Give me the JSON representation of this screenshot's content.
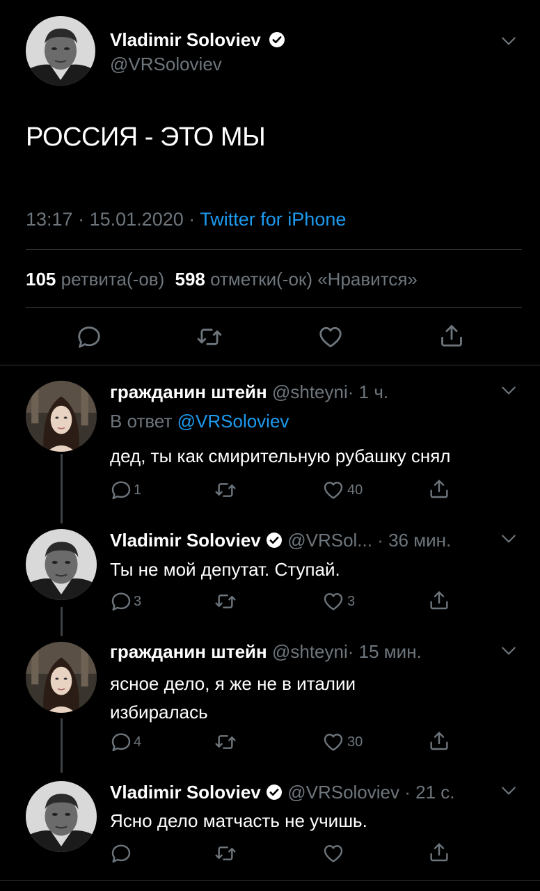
{
  "main_tweet": {
    "author_name": "Vladimir Soloviev",
    "handle": "@VRSoloviev",
    "text": "РОССИЯ - ЭТО МЫ",
    "time": "13:17",
    "sep1": "·",
    "date": "15.01.2020",
    "sep2": "·",
    "source": "Twitter for iPhone",
    "retweets_count": "105",
    "retweets_label": "ретвита(-ов)",
    "likes_count": "598",
    "likes_label": "отметки(-ок) «Нравится»"
  },
  "replies": [
    {
      "author_name": "гражданин штейн",
      "handle": "@shteyni",
      "time": "· 1 ч.",
      "reply_to_label": "В ответ",
      "reply_to_handle": "@VRSoloviev",
      "text": "дед, ты как смирительную рубашку снял",
      "reply_count": "1",
      "like_count": "40"
    },
    {
      "author_name": "Vladimir Soloviev",
      "handle": "@VRSol...",
      "time": "· 36 мин.",
      "text": "Ты не мой депутат. Ступай.",
      "reply_count": "3",
      "like_count": "3"
    },
    {
      "author_name": "гражданин штейн",
      "handle": "@shteyni",
      "time": "· 15 мин.",
      "text_line1": "ясное дело, я же не в италии",
      "text_line2": "избиралась",
      "reply_count": "4",
      "like_count": "30"
    },
    {
      "author_name": "Vladimir Soloviev",
      "handle": "@VRSoloviev",
      "time": "· 21 с.",
      "text": "Ясно дело матчасть не учишь."
    }
  ],
  "icons": [
    "verified-badge-icon",
    "chevron-down-icon",
    "reply-icon",
    "retweet-icon",
    "like-icon",
    "share-icon"
  ],
  "colors": {
    "background": "#000000",
    "link": "#1d9bf0",
    "muted": "#6e767d",
    "divider": "#2f3336"
  }
}
